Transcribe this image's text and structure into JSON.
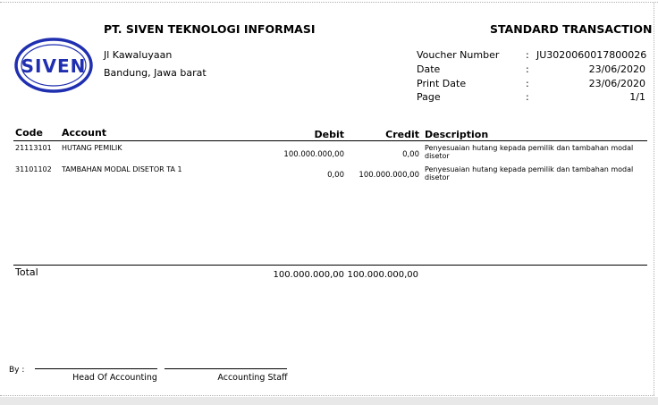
{
  "company": {
    "name": "PT. SIVEN TEKNOLOGI INFORMASI",
    "logo_text": "SIVEN",
    "address_line1": "Jl Kawaluyaan",
    "address_line2": "Bandung, Jawa barat"
  },
  "document_title": "STANDARD TRANSACTION",
  "meta": [
    {
      "label": "Voucher Number",
      "value": "JU3020060017800026"
    },
    {
      "label": "Date",
      "value": "23/06/2020"
    },
    {
      "label": "Print Date",
      "value": "23/06/2020"
    },
    {
      "label": "Page",
      "value": "1/1"
    }
  ],
  "table": {
    "headers": {
      "code": "Code",
      "account": "Account",
      "debit": "Debit",
      "credit": "Credit",
      "description": "Description"
    },
    "rows": [
      {
        "code": "21113101",
        "account": "HUTANG PEMILIK",
        "debit": "100.000.000,00",
        "credit": "0,00",
        "description": "Penyesuaian hutang kepada pemilik dan tambahan modal disetor"
      },
      {
        "code": "31101102",
        "account": "TAMBAHAN MODAL DISETOR TA 1",
        "debit": "0,00",
        "credit": "100.000.000,00",
        "description": "Penyesuaian hutang kepada pemilik dan tambahan modal disetor"
      }
    ],
    "total_label": "Total",
    "total_debit": "100.000.000,00",
    "total_credit": "100.000.000,00"
  },
  "signatures": {
    "by_label": "By :",
    "sig1": "Head Of Accounting",
    "sig2": "Accounting Staff"
  },
  "colors": {
    "logo_blue": "#1f2fb0"
  }
}
